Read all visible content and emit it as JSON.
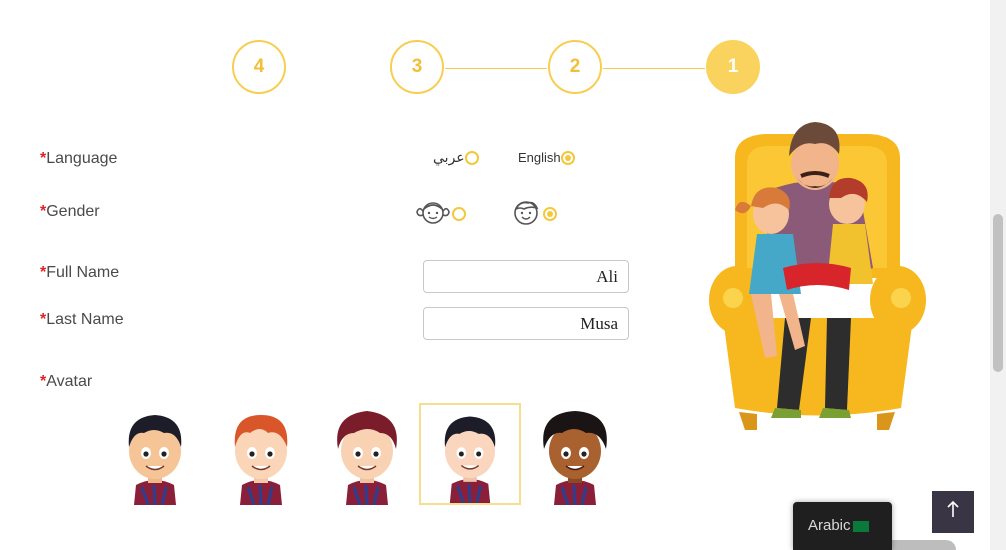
{
  "stepper": {
    "steps": [
      {
        "label": "4",
        "active": false
      },
      {
        "label": "3",
        "active": false
      },
      {
        "label": "2",
        "active": false
      },
      {
        "label": "1",
        "active": true
      }
    ]
  },
  "form": {
    "required_marker": "*",
    "language": {
      "label": "Language",
      "options": [
        {
          "label": "عربي",
          "selected": false
        },
        {
          "label": "English",
          "selected": true
        }
      ]
    },
    "gender": {
      "label": "Gender",
      "options": [
        {
          "icon": "girl-face-icon",
          "selected": false
        },
        {
          "icon": "boy-face-icon",
          "selected": true
        }
      ]
    },
    "full_name": {
      "label": "Full Name",
      "value": "Ali"
    },
    "last_name": {
      "label": "Last Name",
      "value": "Musa"
    },
    "avatar": {
      "label": "Avatar",
      "options": [
        {
          "icon": "boy-avatar-black-hair-icon",
          "selected": false
        },
        {
          "icon": "boy-avatar-ginger-hair-icon",
          "selected": false
        },
        {
          "icon": "boy-avatar-curly-red-hair-icon",
          "selected": false
        },
        {
          "icon": "boy-avatar-black-hair-icon",
          "selected": true
        },
        {
          "icon": "boy-avatar-dark-skin-icon",
          "selected": false
        }
      ]
    }
  },
  "illustration": {
    "icon": "father-reading-to-children-illustration"
  },
  "back_to_top": {
    "icon": "arrow-up-icon"
  },
  "language_switcher": {
    "label": "Arabic",
    "flag_icon": "saudi-flag-icon"
  },
  "colors": {
    "accent": "#fad35f",
    "accent_border": "#f7ce4f",
    "required": "#e02222",
    "back_to_top_bg": "#3a3545",
    "switcher_bg": "#1f1f1f"
  }
}
